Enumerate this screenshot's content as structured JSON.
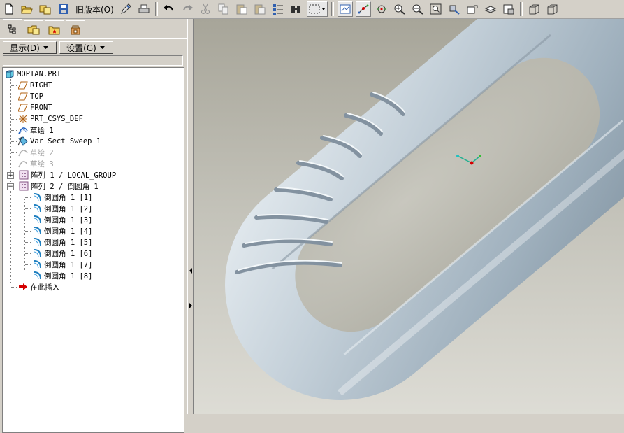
{
  "toolbar": {
    "old_version_label": "旧版本(O)",
    "icons": [
      "new-file-icon",
      "open-file-icon",
      "erase-icon",
      "save-icon",
      "old-version",
      "draw-pen-icon",
      "print-icon",
      "undo-icon",
      "redo-icon",
      "cut-icon",
      "copy-icon",
      "paste-icon",
      "paste-special-icon",
      "regenerate-icon",
      "find-icon",
      "select-box-icon",
      "view-datum-planes-icon",
      "datum-axes-icon",
      "datum-points-icon",
      "zoom-in-icon",
      "zoom-out-icon",
      "refit-icon",
      "orient-icon",
      "saved-views-icon",
      "layers-icon",
      "view-manager-icon",
      "wireframe-icon",
      "hidden-line-icon"
    ]
  },
  "left_panel": {
    "tabs": [
      "model-tree-tab",
      "folder-browser-tab",
      "favorites-tab",
      "connections-tab"
    ],
    "display_menu": "显示(D)",
    "settings_menu": "设置(G)"
  },
  "tree": {
    "root": "MOPIAN.PRT",
    "items": [
      {
        "label": "RIGHT",
        "icon": "datum-plane-icon",
        "dim": false
      },
      {
        "label": "TOP",
        "icon": "datum-plane-icon",
        "dim": false
      },
      {
        "label": "FRONT",
        "icon": "datum-plane-icon",
        "dim": false
      },
      {
        "label": "PRT_CSYS_DEF",
        "icon": "csys-icon",
        "dim": false
      },
      {
        "label": "草绘 1",
        "icon": "sketch-icon",
        "dim": false
      },
      {
        "label": "Var Sect Sweep 1",
        "icon": "sweep-icon",
        "dim": false
      },
      {
        "label": "草绘 2",
        "icon": "sketch-icon",
        "dim": true
      },
      {
        "label": "草绘 3",
        "icon": "sketch-icon",
        "dim": true
      },
      {
        "label": "阵列 1 / LOCAL_GROUP",
        "icon": "pattern-icon",
        "dim": false
      },
      {
        "label": "阵列 2 / 倒圆角 1",
        "icon": "pattern-icon",
        "dim": false
      }
    ],
    "children": [
      "倒圆角 1 [1]",
      "倒圆角 1 [2]",
      "倒圆角 1 [3]",
      "倒圆角 1 [4]",
      "倒圆角 1 [5]",
      "倒圆角 1 [6]",
      "倒圆角 1 [7]",
      "倒圆角 1 [8]"
    ],
    "insert_here": "在此插入"
  },
  "colors": {
    "background_top": "#a7a599",
    "background_bottom": "#dddcd5",
    "part_color": "#b8c6d1",
    "insert_arrow": "#d40000"
  }
}
